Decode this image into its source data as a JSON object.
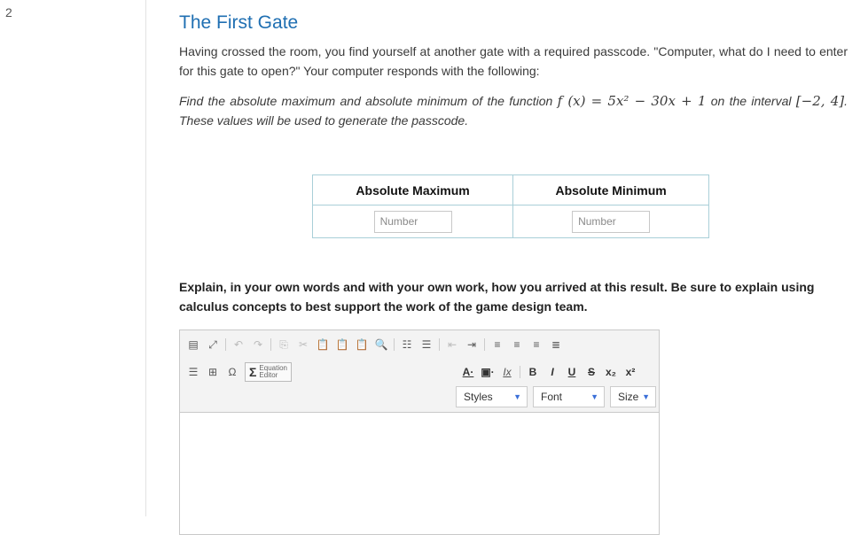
{
  "question_number": "2",
  "title": "The First Gate",
  "intro": "Having crossed the room, you find yourself at another gate with a required passcode. \"Computer, what do I need to enter for this gate to open?\" Your computer responds with the following:",
  "prompt": {
    "before": "Find the absolute maximum and absolute minimum of the function ",
    "function": "f (x) = 5x² − 30x + 1",
    "middle": " on the interval ",
    "interval": "[−2, 4]",
    "after": ". These values will be used to generate the passcode."
  },
  "table": {
    "headers": [
      "Absolute Maximum",
      "Absolute Minimum"
    ],
    "inputs": [
      {
        "placeholder": "Number",
        "value": ""
      },
      {
        "placeholder": "Number",
        "value": ""
      }
    ]
  },
  "explain_text": "Explain, in your own words and with your own work, how you arrived at this result. Be sure to explain using calculus concepts to best support the work of the game design team.",
  "editor": {
    "equation_line1": "Equation",
    "equation_line2": "Editor",
    "styles_label": "Styles",
    "font_label": "Font",
    "size_label": "Size",
    "content": ""
  }
}
